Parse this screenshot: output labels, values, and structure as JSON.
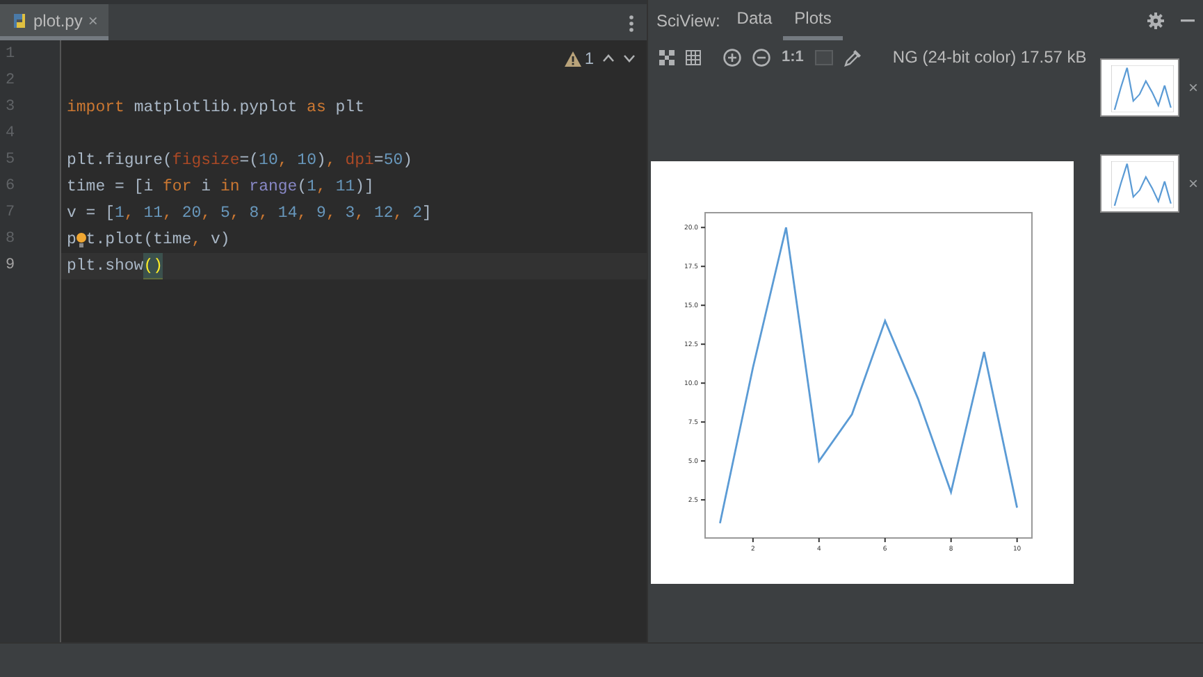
{
  "editor": {
    "tabs": [
      {
        "label": "plot.py",
        "close": "×",
        "selected": true
      }
    ],
    "inspection": {
      "count": "1"
    },
    "lines": [
      {
        "number": "1",
        "current": false
      },
      {
        "number": "2",
        "current": false
      },
      {
        "number": "3",
        "current": false,
        "tokens": [
          {
            "kind": "keyword",
            "text": "import"
          },
          {
            "kind": "plain",
            "text": " matplotlib.pyplot "
          },
          {
            "kind": "keyword",
            "text": "as"
          },
          {
            "kind": "plain",
            "text": " plt"
          }
        ]
      },
      {
        "number": "4",
        "current": false
      },
      {
        "number": "5",
        "current": false,
        "tokens": [
          {
            "kind": "plain",
            "text": "plt.figure("
          },
          {
            "kind": "param",
            "text": "figsize"
          },
          {
            "kind": "plain",
            "text": "=("
          },
          {
            "kind": "number",
            "text": "10"
          },
          {
            "kind": "keyword",
            "text": ", "
          },
          {
            "kind": "number",
            "text": "10"
          },
          {
            "kind": "plain",
            "text": ")"
          },
          {
            "kind": "keyword",
            "text": ", "
          },
          {
            "kind": "param",
            "text": "dpi"
          },
          {
            "kind": "plain",
            "text": "="
          },
          {
            "kind": "number",
            "text": "50"
          },
          {
            "kind": "plain",
            "text": ")"
          }
        ]
      },
      {
        "number": "6",
        "current": false,
        "tokens": [
          {
            "kind": "plain",
            "text": "time = [i "
          },
          {
            "kind": "keyword",
            "text": "for"
          },
          {
            "kind": "plain",
            "text": " i "
          },
          {
            "kind": "keyword",
            "text": "in "
          },
          {
            "kind": "builtin",
            "text": "range"
          },
          {
            "kind": "plain",
            "text": "("
          },
          {
            "kind": "number",
            "text": "1"
          },
          {
            "kind": "keyword",
            "text": ", "
          },
          {
            "kind": "number",
            "text": "11"
          },
          {
            "kind": "plain",
            "text": ")]"
          }
        ]
      },
      {
        "number": "7",
        "current": false,
        "tokens": [
          {
            "kind": "plain",
            "text": "v = ["
          },
          {
            "kind": "number",
            "text": "1"
          },
          {
            "kind": "keyword",
            "text": ", "
          },
          {
            "kind": "number",
            "text": "11"
          },
          {
            "kind": "keyword",
            "text": ", "
          },
          {
            "kind": "number",
            "text": "20"
          },
          {
            "kind": "keyword",
            "text": ", "
          },
          {
            "kind": "number",
            "text": "5"
          },
          {
            "kind": "keyword",
            "text": ", "
          },
          {
            "kind": "number",
            "text": "8"
          },
          {
            "kind": "keyword",
            "text": ", "
          },
          {
            "kind": "number",
            "text": "14"
          },
          {
            "kind": "keyword",
            "text": ", "
          },
          {
            "kind": "number",
            "text": "9"
          },
          {
            "kind": "keyword",
            "text": ", "
          },
          {
            "kind": "number",
            "text": "3"
          },
          {
            "kind": "keyword",
            "text": ", "
          },
          {
            "kind": "number",
            "text": "12"
          },
          {
            "kind": "keyword",
            "text": ", "
          },
          {
            "kind": "number",
            "text": "2"
          },
          {
            "kind": "plain",
            "text": "]"
          }
        ]
      },
      {
        "number": "8",
        "current": false,
        "tokens": [
          {
            "kind": "plain",
            "text": "p"
          },
          {
            "kind": "bulb"
          },
          {
            "kind": "plain",
            "text": "t.plot(time"
          },
          {
            "kind": "keyword",
            "text": ", "
          },
          {
            "kind": "plain",
            "text": "v)"
          }
        ]
      },
      {
        "number": "9",
        "current": true,
        "tokens": [
          {
            "kind": "plain",
            "text": "plt.show"
          },
          {
            "kind": "brace",
            "text": "()"
          }
        ]
      }
    ]
  },
  "sciview": {
    "label": "SciView:",
    "tabs": [
      {
        "label": "Data",
        "selected": false
      },
      {
        "label": "Plots",
        "selected": true
      }
    ],
    "zoom_label": "1:1",
    "image_info": "NG (24-bit color) 17.57 kB",
    "thumbnails": [
      {
        "close": "×"
      },
      {
        "close": "×"
      }
    ],
    "plot": {
      "chart_data": {
        "type": "line",
        "x": [
          1,
          2,
          3,
          4,
          5,
          6,
          7,
          8,
          9,
          10
        ],
        "series": [
          {
            "color": "#5b9bd5",
            "values": [
              1,
              11,
              20,
              5,
              8,
              14,
              9,
              3,
              12,
              2
            ]
          }
        ],
        "xlim": [
          0.55,
          10.45
        ],
        "ylim": [
          0.05,
          20.95
        ],
        "xticks": [
          2,
          4,
          6,
          8,
          10
        ],
        "yticks": [
          {
            "value": 2.5,
            "label": "2.5"
          },
          {
            "value": 5,
            "label": "5.0"
          },
          {
            "value": 7.5,
            "label": "7.5"
          },
          {
            "value": 10,
            "label": "10.0"
          },
          {
            "value": 12.5,
            "label": "12.5"
          },
          {
            "value": 15,
            "label": "15.0"
          },
          {
            "value": 17.5,
            "label": "17.5"
          },
          {
            "value": 20,
            "label": "20.0"
          }
        ]
      }
    }
  }
}
